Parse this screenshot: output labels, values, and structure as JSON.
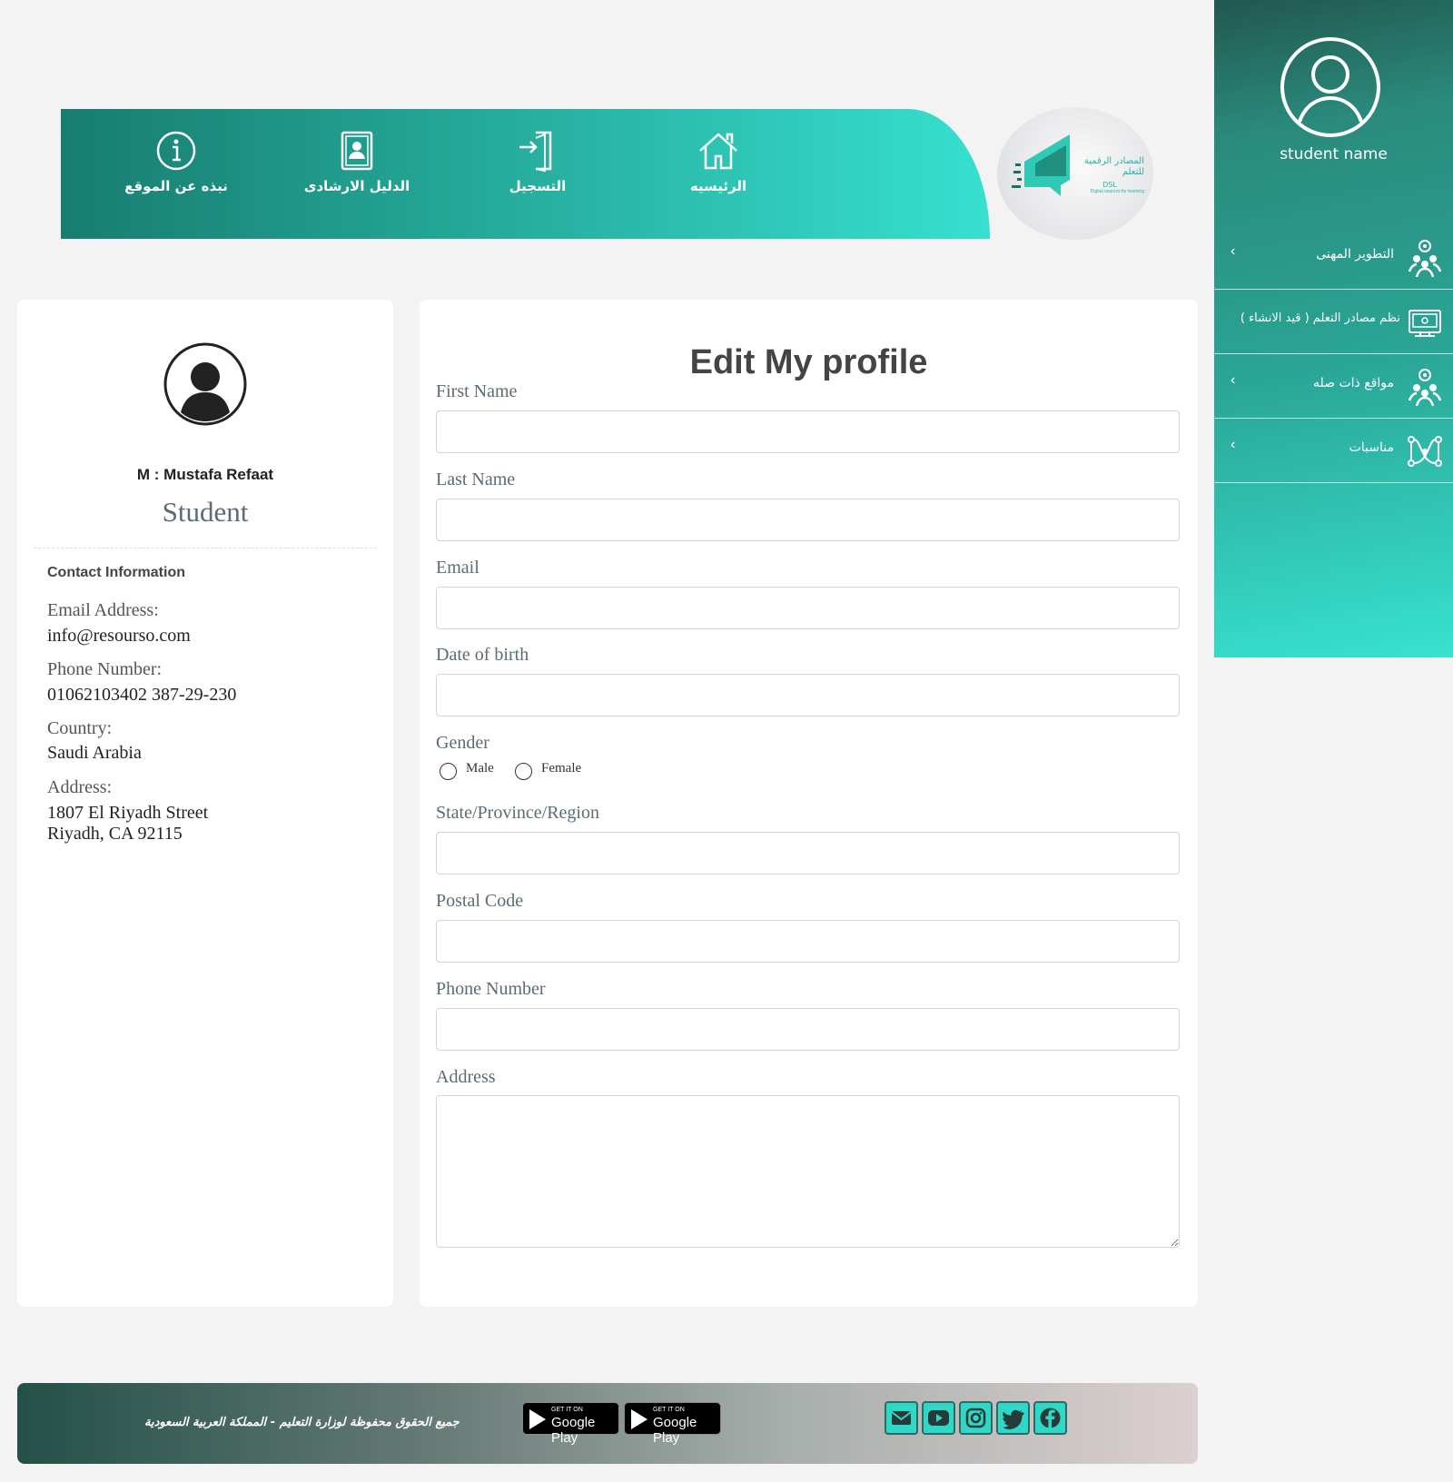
{
  "nav": {
    "items": [
      {
        "label": "نبذه عن الموقع",
        "icon": "info-icon"
      },
      {
        "label": "الدليل الارشادى",
        "icon": "guide-icon"
      },
      {
        "label": "التسجيل",
        "icon": "login-icon"
      },
      {
        "label": "الرئيسيه",
        "icon": "home-icon"
      }
    ],
    "logo_text": "المصادر الرقمية للتعلم",
    "logo_abbr": "DSL",
    "logo_sub": "Digital sources for learning"
  },
  "sidebar": {
    "user_name": "student name",
    "items": [
      {
        "label": "التطوير المهنى",
        "icon": "team-gear-icon",
        "has_chevron": true
      },
      {
        "label": "نظم مصادر التعلم ( قيد الانشاء )",
        "icon": "screen-icon",
        "has_chevron": false
      },
      {
        "label": "مواقع ذات صله",
        "icon": "team-gear-icon",
        "has_chevron": true
      },
      {
        "label": "مناسبات",
        "icon": "network-icon",
        "has_chevron": true
      }
    ],
    "chevron": "‹"
  },
  "profile": {
    "name": "M : Mustafa Refaat",
    "role": "Student",
    "contact_title": "Contact Information",
    "email_label": "Email Address:",
    "email": "info@resourso.com",
    "phone_label": "Phone Number:",
    "phone": "01062103402 387-29-230",
    "country_label": "Country:",
    "country": "Saudi Arabia",
    "address_label": "Address:",
    "address": "1807 El Riyadh Street\nRiyadh, CA 92115"
  },
  "form": {
    "title": "Edit My profile",
    "first_name": {
      "label": "First Name",
      "value": ""
    },
    "last_name": {
      "label": "Last Name",
      "value": ""
    },
    "email": {
      "label": "Email",
      "value": ""
    },
    "dob": {
      "label": "Date of birth",
      "value": ""
    },
    "gender": {
      "label": "Gender",
      "options": [
        "Male",
        "Female"
      ],
      "selected": ""
    },
    "state": {
      "label": "State/Province/Region",
      "value": ""
    },
    "postal": {
      "label": "Postal Code",
      "value": ""
    },
    "phone": {
      "label": "Phone Number",
      "value": ""
    },
    "address": {
      "label": "Address",
      "value": ""
    }
  },
  "footer": {
    "copyright": "جميع الحقوق محفوظة لوزارة التعليم - المملكة العربية السعودية",
    "badges": [
      {
        "small": "GET IT ON",
        "big": "Google Play"
      },
      {
        "small": "GET IT ON",
        "big": "Google Play"
      }
    ],
    "social": [
      "email-icon",
      "youtube-icon",
      "instagram-icon",
      "twitter-icon",
      "facebook-icon"
    ]
  },
  "colors": {
    "accent": "#2aa596",
    "accent_light": "#37e0cf",
    "accent_dark": "#177d70"
  }
}
